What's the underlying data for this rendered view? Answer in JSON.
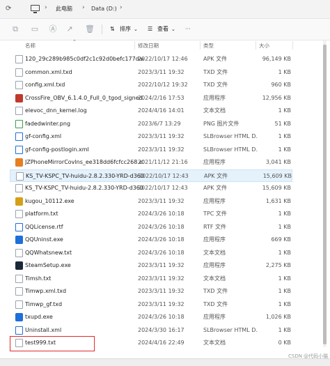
{
  "address": {
    "path": [
      "此电脑",
      "Data (D:)"
    ]
  },
  "toolbar": {
    "sort_label": "排序",
    "view_label": "查看",
    "more_label": "···"
  },
  "columns": {
    "name": "名称",
    "date": "修改日期",
    "type": "类型",
    "size": "大小"
  },
  "files": [
    {
      "name": "120_29c289b985c0df2c1c92d0befc177dad...",
      "date": "2022/10/17 12:46",
      "type": "APK 文件",
      "size": "96,149 KB",
      "icon": "apk-icon",
      "color": "#9aa3ad"
    },
    {
      "name": "common.xml.txd",
      "date": "2023/3/11 19:32",
      "type": "TXD 文件",
      "size": "1 KB",
      "icon": "file-icon",
      "color": "#9aa3ad"
    },
    {
      "name": "config.xml.txd",
      "date": "2022/10/12 19:32",
      "type": "TXD 文件",
      "size": "960 KB",
      "icon": "file-icon",
      "color": "#9aa3ad"
    },
    {
      "name": "CrossFire_OBV_6.1.4.0_Full_0_tgod_signed.e...",
      "date": "2024/2/16 17:53",
      "type": "应用程序",
      "size": "12,956 KB",
      "icon": "app-icon",
      "color": "#c0392b"
    },
    {
      "name": "elevoc_dnn_kernel.log",
      "date": "2024/4/16 14:01",
      "type": "文本文档",
      "size": "1 KB",
      "icon": "txt-icon",
      "color": "#9aa3ad"
    },
    {
      "name": "fadedwinter.png",
      "date": "2023/6/7 13:29",
      "type": "PNG 图片文件",
      "size": "51 KB",
      "icon": "image-icon",
      "color": "#3a9e4a"
    },
    {
      "name": "gf-config.xml",
      "date": "2023/3/11 19:32",
      "type": "SLBrowser HTML D...",
      "size": "1 KB",
      "icon": "browser-icon",
      "color": "#1e6fd9"
    },
    {
      "name": "gf-config-postlogin.xml",
      "date": "2023/3/11 19:32",
      "type": "SLBrowser HTML D...",
      "size": "1 KB",
      "icon": "browser-icon",
      "color": "#1e6fd9"
    },
    {
      "name": "JZPhoneMirrorCovlns_ee318dd6fcfcc268.exe",
      "date": "2021/11/12 21:16",
      "type": "应用程序",
      "size": "3,041 KB",
      "icon": "app-icon",
      "color": "#e67e22"
    },
    {
      "name": "KS_TV-KSPC_TV-huidu-2.8.2.330-YRD-d360...",
      "date": "2022/10/17 12:43",
      "type": "APK 文件",
      "size": "15,609 KB",
      "icon": "apk-icon",
      "color": "#9aa3ad",
      "selected": true
    },
    {
      "name": "KS_TV-KSPC_TV-huidu-2.8.2.330-YRD-d360...",
      "date": "2022/10/17 12:43",
      "type": "APK 文件",
      "size": "15,609 KB",
      "icon": "apk-icon",
      "color": "#9aa3ad"
    },
    {
      "name": "kugou_10112.exe",
      "date": "2023/3/11 19:32",
      "type": "应用程序",
      "size": "1,631 KB",
      "icon": "app-icon",
      "color": "#d4a017"
    },
    {
      "name": "platform.txt",
      "date": "2024/3/26 10:18",
      "type": "TPC 文件",
      "size": "1 KB",
      "icon": "file-icon",
      "color": "#9aa3ad"
    },
    {
      "name": "QQLicense.rtf",
      "date": "2024/3/26 10:18",
      "type": "RTF 文件",
      "size": "1 KB",
      "icon": "rtf-icon",
      "color": "#1e6fd9"
    },
    {
      "name": "QQUninst.exe",
      "date": "2024/3/26 10:18",
      "type": "应用程序",
      "size": "669 KB",
      "icon": "app-icon",
      "color": "#1e6fd9"
    },
    {
      "name": "QQWhatsnew.txt",
      "date": "2024/3/26 10:18",
      "type": "文本文档",
      "size": "1 KB",
      "icon": "txt-icon",
      "color": "#9aa3ad"
    },
    {
      "name": "SteamSetup.exe",
      "date": "2023/3/11 19:32",
      "type": "应用程序",
      "size": "2,275 KB",
      "icon": "app-icon",
      "color": "#1b2838"
    },
    {
      "name": "Timsh.txt",
      "date": "2023/3/11 19:32",
      "type": "文本文档",
      "size": "1 KB",
      "icon": "txt-icon",
      "color": "#9aa3ad"
    },
    {
      "name": "Timwp.xml.txd",
      "date": "2023/3/11 19:32",
      "type": "TXD 文件",
      "size": "1 KB",
      "icon": "file-icon",
      "color": "#9aa3ad"
    },
    {
      "name": "Timwp_gf.txd",
      "date": "2023/3/11 19:32",
      "type": "TXD 文件",
      "size": "1 KB",
      "icon": "file-icon",
      "color": "#9aa3ad"
    },
    {
      "name": "txupd.exe",
      "date": "2024/3/26 10:18",
      "type": "应用程序",
      "size": "1,026 KB",
      "icon": "app-icon",
      "color": "#1e6fd9"
    },
    {
      "name": "Uninstall.xml",
      "date": "2024/3/30 16:17",
      "type": "SLBrowser HTML D...",
      "size": "1 KB",
      "icon": "browser-icon",
      "color": "#1e6fd9"
    },
    {
      "name": "test999.txt",
      "date": "2024/4/16 22:49",
      "type": "文本文档",
      "size": "0 KB",
      "icon": "txt-icon",
      "color": "#9aa3ad"
    }
  ],
  "watermark": "CSDN @代码小猫"
}
